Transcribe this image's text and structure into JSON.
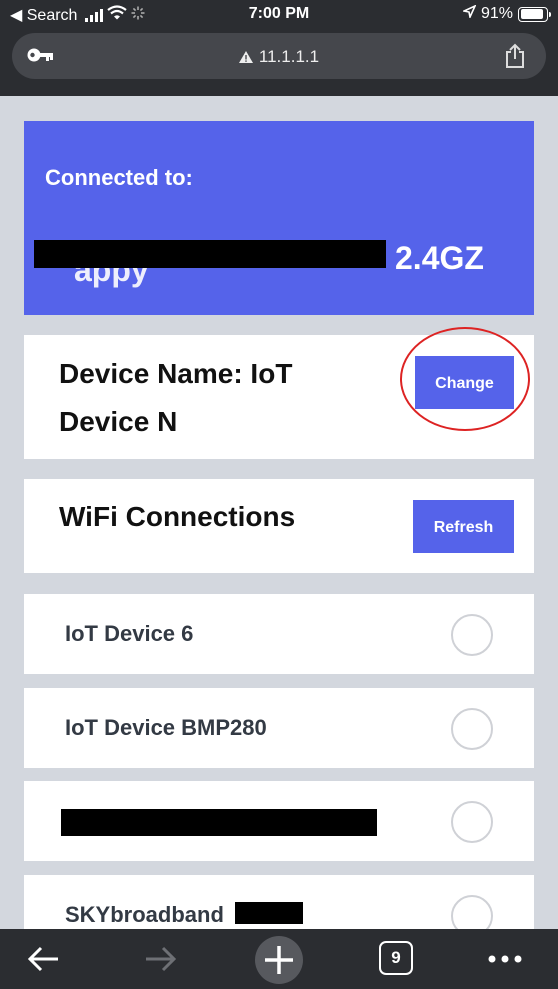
{
  "status_bar": {
    "back_label": "◀ Search",
    "time": "7:00 PM",
    "battery": "91%",
    "battery_level": 0.91
  },
  "browser": {
    "url": "11.1.1.1",
    "tab_count": "9"
  },
  "connection": {
    "label": "Connected to:",
    "ssid_hidden_text": "appy",
    "ssid_suffix": "2.4GZ",
    "accent": "#5563ea"
  },
  "device": {
    "name": "Device Name: IoT Device N",
    "change_label": "Change"
  },
  "wifi": {
    "title": "WiFi Connections",
    "refresh_label": "Refresh",
    "networks": [
      {
        "label": "IoT Device 6"
      },
      {
        "label": "IoT Device BMP280"
      },
      {
        "label": ""
      },
      {
        "label": "SKYbroadband"
      }
    ]
  }
}
